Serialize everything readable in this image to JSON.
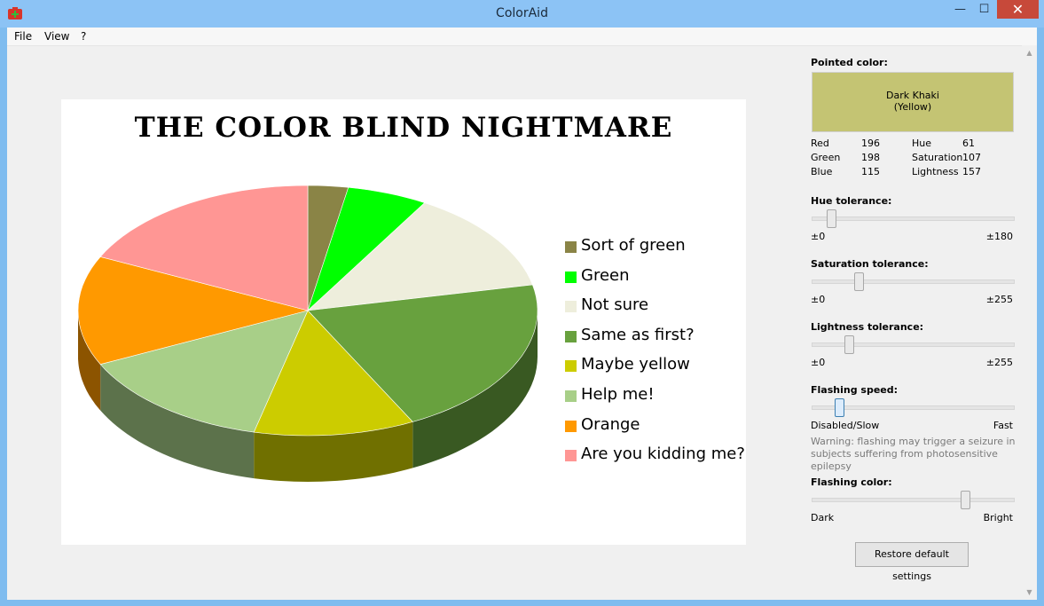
{
  "window": {
    "title": "ColorAid",
    "minimize_glyph": "—",
    "maximize_glyph": "☐",
    "close_glyph": "✕"
  },
  "menu": {
    "file": "File",
    "view": "View",
    "help": "?"
  },
  "chart": {
    "title": "THE COLOR BLIND NIGHTMARE"
  },
  "chart_data": {
    "type": "pie",
    "title": "THE COLOR BLIND NIGHTMARE",
    "categories": [
      "Sort of green",
      "Green",
      "Not sure",
      "Same as first?",
      "Maybe yellow",
      "Help me!",
      "Orange",
      "Are you kidding me?"
    ],
    "values": [
      3,
      6,
      14,
      22,
      12,
      15,
      15,
      19
    ],
    "colors": [
      "#8a8446",
      "#00ff00",
      "#eeeedc",
      "#68a13e",
      "#cccc00",
      "#a8cf88",
      "#ff9900",
      "#ff9694"
    ],
    "legend_position": "right"
  },
  "panel": {
    "pointed_color_label": "Pointed color:",
    "color_name": "Dark Khaki",
    "color_family": "(Yellow)",
    "swatch_color": "#c4c473",
    "rgb": {
      "red_label": "Red",
      "red": "196",
      "green_label": "Green",
      "green": "198",
      "blue_label": "Blue",
      "blue": "115"
    },
    "hsl": {
      "hue_label": "Hue",
      "hue": "61",
      "sat_label": "Saturation",
      "sat": "107",
      "light_label": "Lightness",
      "light": "157"
    },
    "hue_tolerance": {
      "label": "Hue tolerance:",
      "min": "±0",
      "max": "±180",
      "value": 0.08
    },
    "sat_tolerance": {
      "label": "Saturation tolerance:",
      "min": "±0",
      "max": "±255",
      "value": 0.22
    },
    "light_tolerance": {
      "label": "Lightness tolerance:",
      "min": "±0",
      "max": "±255",
      "value": 0.17
    },
    "flashing_speed": {
      "label": "Flashing speed:",
      "min": "Disabled/Slow",
      "max": "Fast",
      "value": 0.12
    },
    "warning": "Warning: flashing may trigger a seizure in subjects suffering from photosensitive epilepsy",
    "flashing_color": {
      "label": "Flashing color:",
      "min": "Dark",
      "max": "Bright",
      "value": 0.78
    },
    "restore_button": "Restore default settings"
  }
}
